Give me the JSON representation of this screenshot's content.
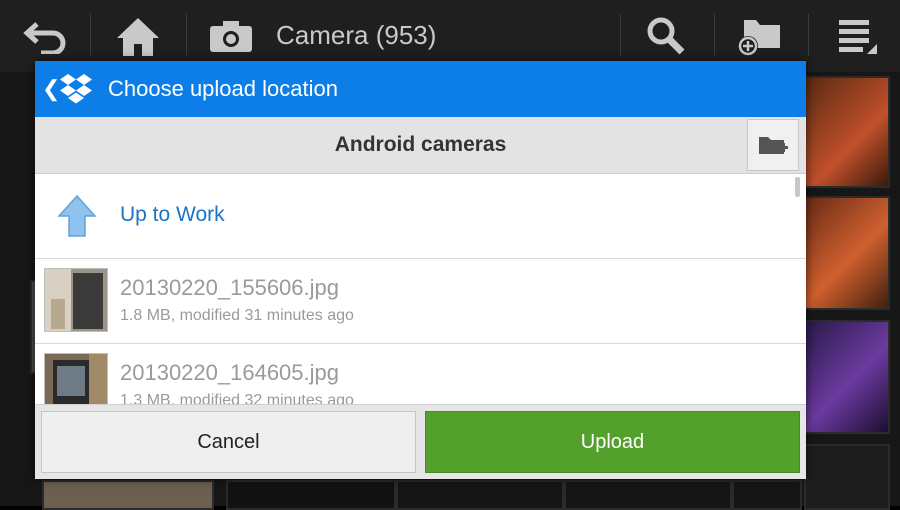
{
  "app_bar": {
    "title": "Camera (953)",
    "icons": [
      "back-icon",
      "home-icon",
      "camera-icon",
      "search-icon",
      "new-folder-icon",
      "menu-icon"
    ]
  },
  "dialog": {
    "title": "Choose upload location",
    "folder_name": "Android cameras",
    "up_label": "Up to Work",
    "files": [
      {
        "name": "20130220_155606.jpg",
        "meta": "1.8 MB, modified 31 minutes ago"
      },
      {
        "name": "20130220_164605.jpg",
        "meta": "1.3 MB, modified 32 minutes ago"
      }
    ],
    "cancel_label": "Cancel",
    "upload_label": "Upload"
  },
  "colors": {
    "header_blue": "#0d7ee8",
    "upload_green": "#53a12c",
    "link_blue": "#1a73c8"
  }
}
